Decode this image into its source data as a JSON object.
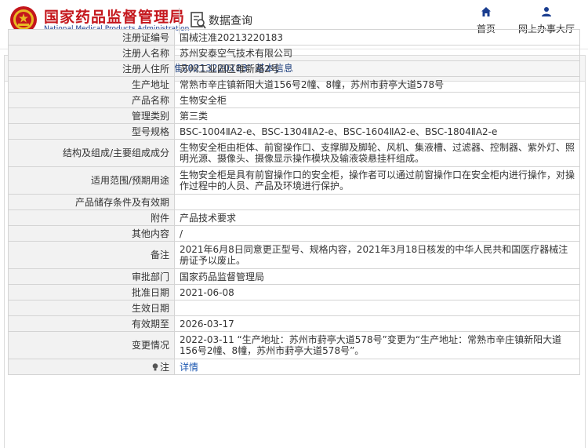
{
  "header": {
    "site_name_cn": "国家药品监督管理局",
    "site_name_en": "National Medical Products Administration",
    "query_title": "数据查询",
    "nav": [
      {
        "icon": "home-icon",
        "label": "首页"
      },
      {
        "icon": "user-icon",
        "label": "网上办事大厅"
      }
    ]
  },
  "colors": {
    "brand_red": "#c4161c",
    "brand_blue": "#1a3d8f",
    "link": "#1a56b0"
  },
  "panel": {
    "title": "境内医疗器械（注册） —— “国械注准20213220183” 基本信息"
  },
  "rows": [
    {
      "label": "注册证编号",
      "value": "国械注准20213220183"
    },
    {
      "label": "注册人名称",
      "value": "苏州安泰空气技术有限公司"
    },
    {
      "label": "注册人住所",
      "value": "苏州工业园区唯新路2号"
    },
    {
      "label": "生产地址",
      "value": "常熟市辛庄镇新阳大道156号2幢、8幢，苏州市葑亭大道578号"
    },
    {
      "label": "产品名称",
      "value": "生物安全柜"
    },
    {
      "label": "管理类别",
      "value": "第三类"
    },
    {
      "label": "型号规格",
      "value": "BSC-1004ⅡA2-e、BSC-1304ⅡA2-e、BSC-1604ⅡA2-e、BSC-1804ⅡA2-e"
    },
    {
      "label": "结构及组成/主要组成成分",
      "value": "生物安全柜由柜体、前窗操作口、支撑脚及脚轮、风机、集液槽、过滤器、控制器、紫外灯、照明光源、摄像头、摄像显示操作模块及输液袋悬挂杆组成。"
    },
    {
      "label": "适用范围/预期用途",
      "value": "生物安全柜是具有前窗操作口的安全柜，操作者可以通过前窗操作口在安全柜内进行操作，对操作过程中的人员、产品及环境进行保护。"
    },
    {
      "label": "产品储存条件及有效期",
      "value": ""
    },
    {
      "label": "附件",
      "value": "产品技术要求"
    },
    {
      "label": "其他内容",
      "value": "/"
    },
    {
      "label": "备注",
      "value": "2021年6月8日同意更正型号、规格内容，2021年3月18日核发的中华人民共和国医疗器械注册证予以废止。"
    },
    {
      "label": "审批部门",
      "value": "国家药品监督管理局"
    },
    {
      "label": "批准日期",
      "value": "2021-06-08"
    },
    {
      "label": "生效日期",
      "value": ""
    },
    {
      "label": "有效期至",
      "value": "2026-03-17"
    },
    {
      "label": "变更情况",
      "value": "2022-03-11 “生产地址：苏州市葑亭大道578号”变更为“生产地址：常熟市辛庄镇新阳大道156号2幢、8幢，苏州市葑亭大道578号”。"
    },
    {
      "label": "注",
      "value": "详情"
    }
  ]
}
